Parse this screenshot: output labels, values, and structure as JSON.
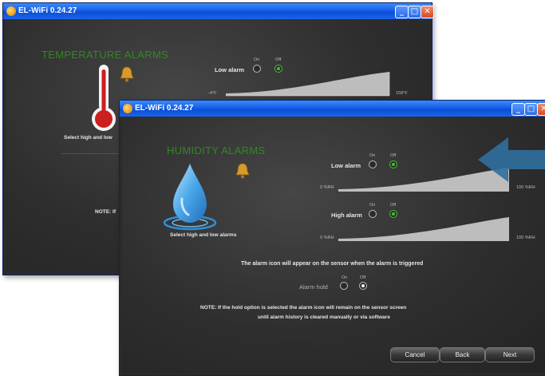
{
  "window_back": {
    "title": "EL-WiFi 0.24.27",
    "heading": "TEMPERATURE ALARMS",
    "low_alarm_label": "Low alarm",
    "on_label": "On",
    "off_label": "Off",
    "range_min": "-4°F",
    "range_max": "158°F",
    "select_text": "Select high and low",
    "partial_text_1": "T",
    "note_partial": "NOTE: If"
  },
  "window_front": {
    "title": "EL-WiFi 0.24.27",
    "heading": "HUMIDITY ALARMS",
    "select_text": "Select high and low alarms",
    "low_alarm": {
      "label": "Low alarm",
      "on": "On",
      "off": "Off",
      "min": "0 %RH",
      "max": "100 %RH"
    },
    "high_alarm": {
      "label": "High alarm",
      "on": "On",
      "off": "Off",
      "min": "0 %RH",
      "max": "100 %RH"
    },
    "info_text": "The alarm icon will appear on the sensor when the alarm is triggered",
    "alarm_hold": {
      "label": "Alarm hold",
      "on": "On",
      "off": "Off"
    },
    "note_line1": "NOTE: If the hold option is selected the alarm icon will remain on the sensor screen",
    "note_line2": "until alarm history is cleared manually or via software",
    "buttons": {
      "cancel": "Cancel",
      "back": "Back",
      "next": "Next"
    }
  },
  "icons": [
    "app-icon",
    "thermometer-icon",
    "bell-icon",
    "water-drop-icon",
    "arrow-icon",
    "minimize-icon",
    "maximize-icon",
    "close-icon"
  ],
  "colors": {
    "titlebar": "#1660e8",
    "heading_green": "#2e8b1e",
    "radio_green": "#46c12a",
    "drop_blue": "#3a9ee6",
    "thermo_red": "#cc1f1f",
    "arrow_blue": "#2f6f9e"
  }
}
